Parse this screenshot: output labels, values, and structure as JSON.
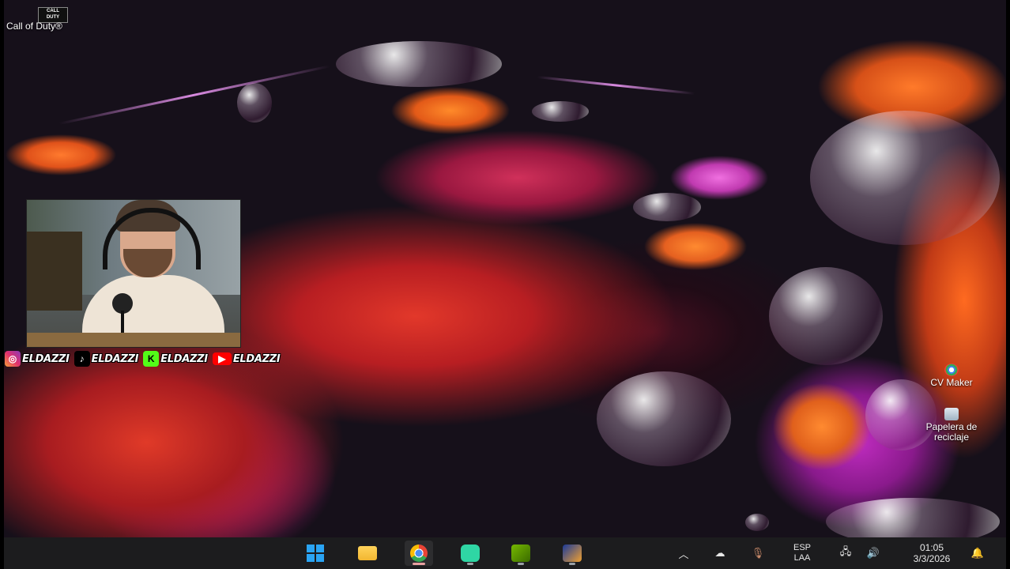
{
  "desktop": {
    "shortcuts": {
      "call_of_duty": {
        "label": "Call of Duty®",
        "icon_text": "CALL\nDUTY"
      },
      "cv_maker": {
        "label": "CV Maker"
      },
      "recycle_bin": {
        "label": "Papelera de reciclaje"
      }
    }
  },
  "stream_overlay": {
    "socials": [
      {
        "platform": "instagram",
        "icon": "instagram-icon",
        "handle": "ELDAZZI"
      },
      {
        "platform": "tiktok",
        "icon": "tiktok-icon",
        "handle": "ELDAZZI"
      },
      {
        "platform": "kick",
        "icon": "kick-icon",
        "handle": "ELDAZZI"
      },
      {
        "platform": "youtube",
        "icon": "youtube-icon",
        "handle": "ELDAZZI"
      }
    ]
  },
  "taskbar": {
    "apps": [
      {
        "name": "start",
        "icon": "windows-icon"
      },
      {
        "name": "file-explorer",
        "icon": "folder-icon"
      },
      {
        "name": "chrome",
        "icon": "chrome-icon",
        "active": true
      },
      {
        "name": "discord",
        "icon": "discord-icon"
      },
      {
        "name": "nvidia",
        "icon": "nvidia-icon"
      },
      {
        "name": "counter-strike",
        "icon": "counter-strike-icon"
      }
    ],
    "tray": {
      "language": {
        "line1": "ESP",
        "line2": "LAA"
      },
      "clock": {
        "time": "01:05",
        "date": "3/3/2026"
      }
    }
  },
  "colors": {
    "taskbar_bg": "#1c1c1e",
    "kick_green": "#53fc18",
    "youtube_red": "#ff0000"
  }
}
